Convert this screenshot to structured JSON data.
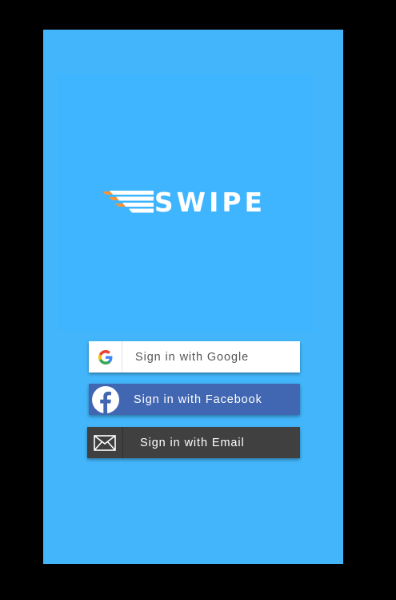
{
  "app": {
    "logo_text": "SWIPE",
    "logo_icon": "wings-icon"
  },
  "colors": {
    "background": "#43b6fb",
    "logo_panel": "#3fb5ff",
    "google_button": "#ffffff",
    "facebook_button": "#4166b2",
    "email_button": "#404040",
    "wing_orange": "#f0953e"
  },
  "signin": {
    "google": {
      "label": "Sign in with Google",
      "icon": "google-g-icon"
    },
    "facebook": {
      "label": "Sign in with Facebook",
      "icon": "facebook-f-icon"
    },
    "email": {
      "label": "Sign in with Email",
      "icon": "envelope-icon"
    }
  }
}
